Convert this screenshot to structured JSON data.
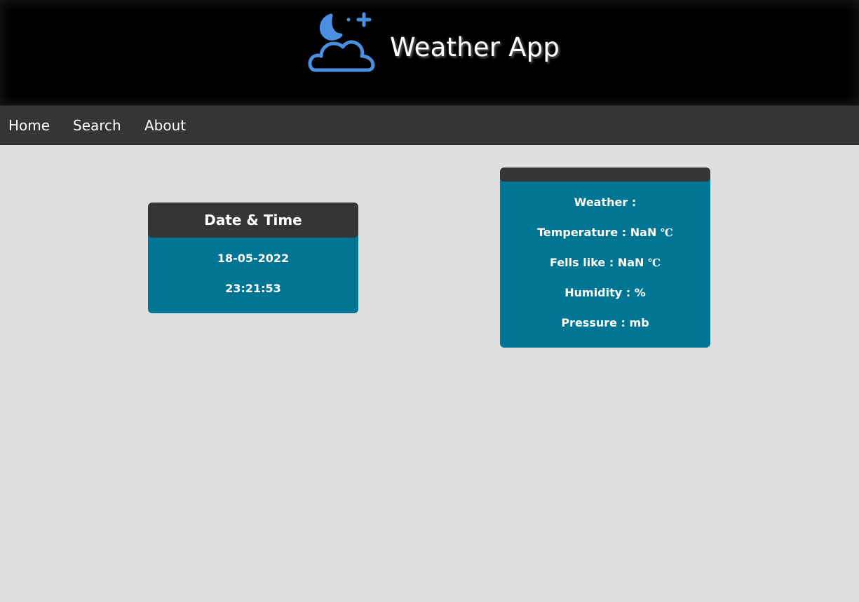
{
  "app": {
    "title": "Weather App",
    "logo_icon": "cloud-moon-stars-icon",
    "accent_color": "#4a90e2"
  },
  "nav": {
    "items": [
      {
        "label": "Home"
      },
      {
        "label": "Search"
      },
      {
        "label": "About"
      }
    ]
  },
  "datetime_card": {
    "title": "Date & Time",
    "date": "18-05-2022",
    "time": "23:21:53"
  },
  "weather_card": {
    "title": "",
    "weather_label": "Weather :",
    "weather_value": "",
    "temperature_label": "Temperature :",
    "temperature_value": "NaN",
    "temperature_unit": "℃",
    "feels_like_label": "Fells like :",
    "feels_like_value": "NaN",
    "feels_like_unit": "℃",
    "humidity_label": "Humidity :",
    "humidity_value": "",
    "humidity_unit": "%",
    "pressure_label": "Pressure :",
    "pressure_value": "",
    "pressure_unit": "mb"
  },
  "colors": {
    "header_bg": "#000000",
    "nav_bg": "#353535",
    "page_bg": "#dfdfdf",
    "card_bg": "#007694",
    "card_header_bg": "#353535"
  }
}
